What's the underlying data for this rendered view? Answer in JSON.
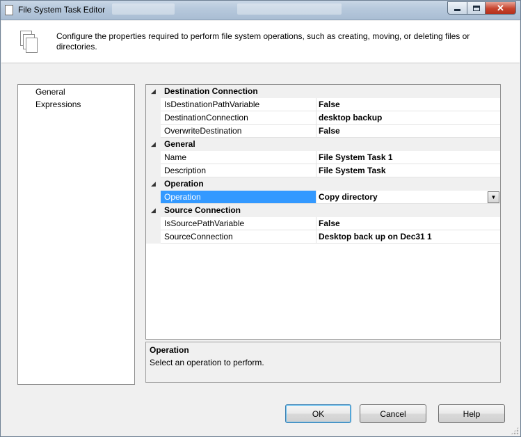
{
  "window": {
    "title": "File System Task Editor"
  },
  "banner": {
    "description": "Configure the properties required to perform file system operations, such as creating, moving, or deleting files or directories."
  },
  "nav": {
    "items": [
      {
        "label": "General",
        "selected": true
      },
      {
        "label": "Expressions",
        "selected": false
      }
    ]
  },
  "grid": {
    "categories": [
      {
        "label": "Destination Connection",
        "properties": [
          {
            "name": "IsDestinationPathVariable",
            "value": "False"
          },
          {
            "name": "DestinationConnection",
            "value": "desktop backup"
          },
          {
            "name": "OverwriteDestination",
            "value": "False"
          }
        ]
      },
      {
        "label": "General",
        "properties": [
          {
            "name": "Name",
            "value": "File System Task 1"
          },
          {
            "name": "Description",
            "value": "File System Task"
          }
        ]
      },
      {
        "label": "Operation",
        "properties": [
          {
            "name": "Operation",
            "value": "Copy directory",
            "selected": true
          }
        ]
      },
      {
        "label": "Source Connection",
        "properties": [
          {
            "name": "IsSourcePathVariable",
            "value": "False"
          },
          {
            "name": "SourceConnection",
            "value": "Desktop back up on Dec31 1"
          }
        ]
      }
    ]
  },
  "description_pane": {
    "title": "Operation",
    "text": "Select an operation to perform."
  },
  "buttons": {
    "ok": "OK",
    "cancel": "Cancel",
    "help": "Help"
  },
  "colors": {
    "selection": "#3399ff",
    "dialog_bg": "#f0f0f0",
    "default_button_border": "#3c7fb1"
  },
  "icons": {
    "title": "document-icon",
    "banner": "stacked-pages-icon",
    "collapse": "collapse-triangle-icon",
    "dropdown": "chevron-down-icon"
  }
}
